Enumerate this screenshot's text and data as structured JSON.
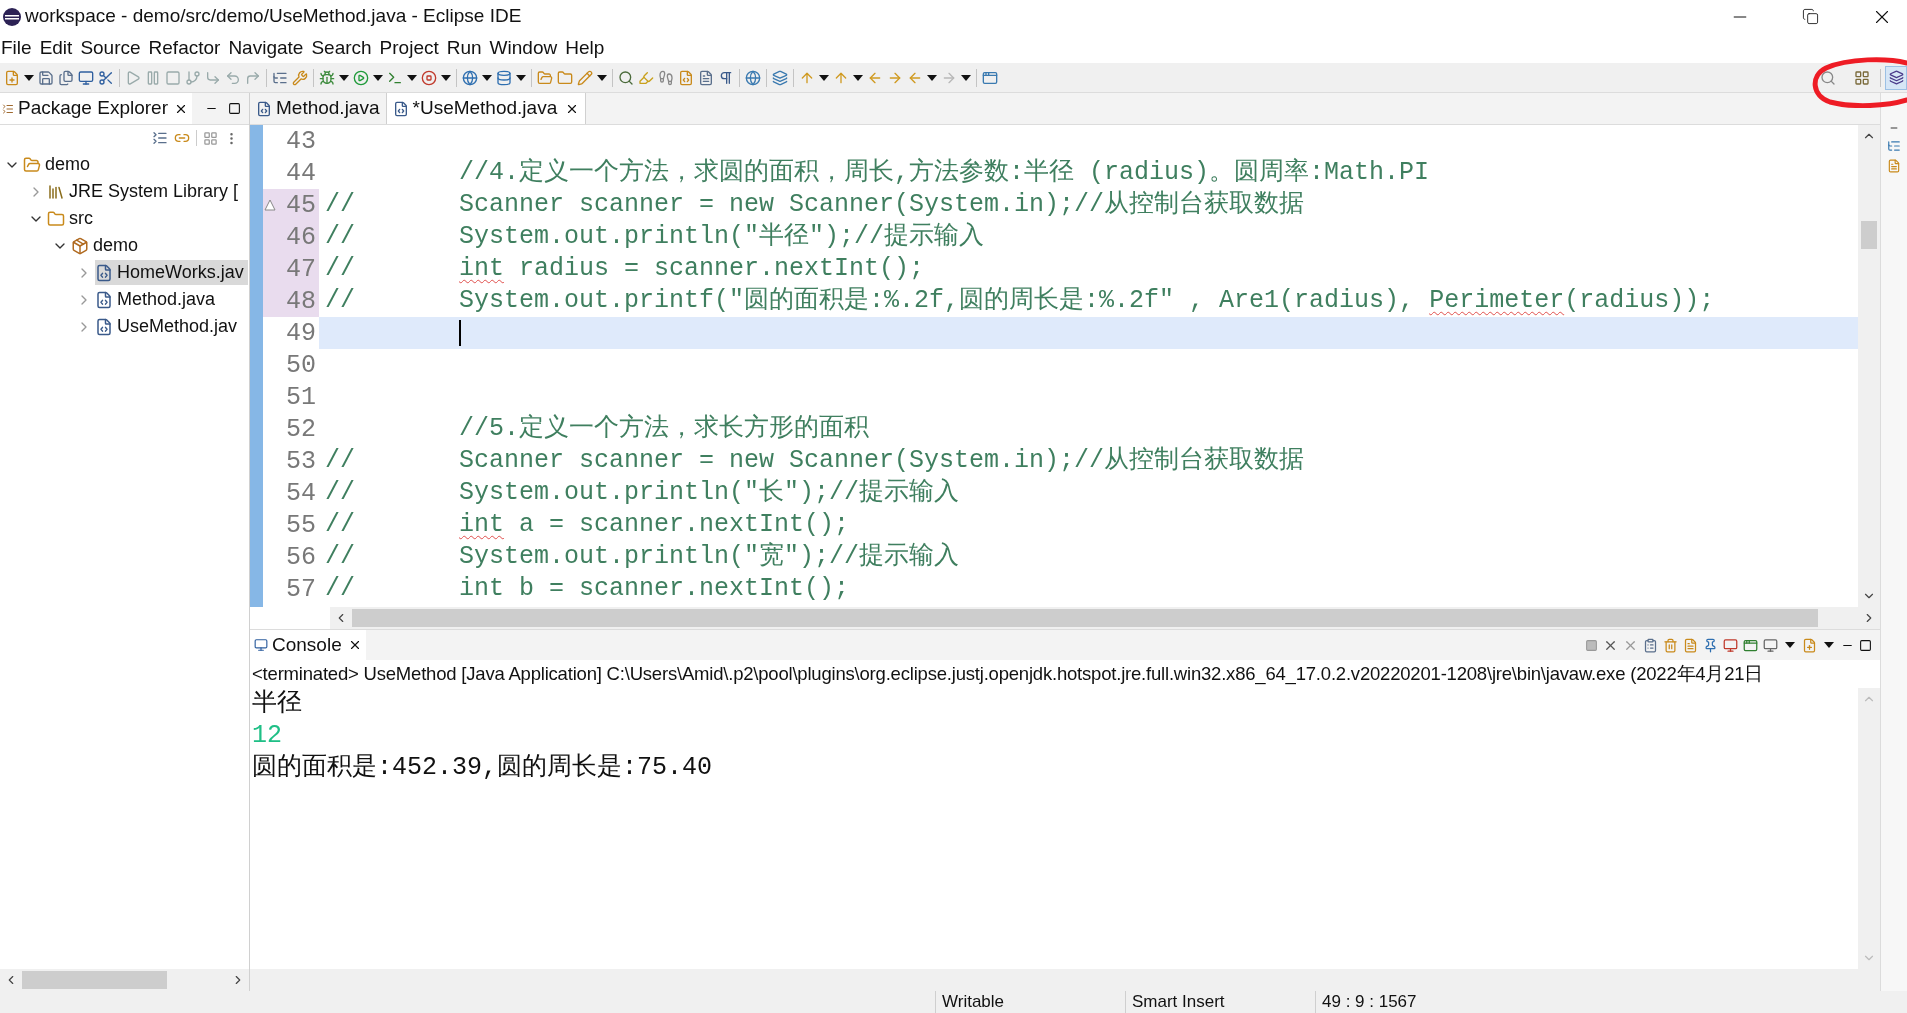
{
  "window": {
    "title": "workspace - demo/src/demo/UseMethod.java - Eclipse IDE"
  },
  "menu": [
    "File",
    "Edit",
    "Source",
    "Refactor",
    "Navigate",
    "Search",
    "Project",
    "Run",
    "Window",
    "Help"
  ],
  "package_explorer": {
    "title": "Package Explorer",
    "tree": [
      {
        "label": "demo",
        "kind": "project",
        "expanded": true,
        "selected": false,
        "children": [
          {
            "label": "JRE System Library [",
            "kind": "library",
            "expanded": false,
            "selected": false
          },
          {
            "label": "src",
            "kind": "source-folder",
            "expanded": true,
            "selected": false,
            "children": [
              {
                "label": "demo",
                "kind": "package",
                "expanded": true,
                "selected": false,
                "children": [
                  {
                    "label": "HomeWorks.jav",
                    "kind": "java-file",
                    "expanded": false,
                    "selected": true
                  },
                  {
                    "label": "Method.java",
                    "kind": "java-file",
                    "expanded": false,
                    "selected": false
                  },
                  {
                    "label": "UseMethod.jav",
                    "kind": "java-file",
                    "expanded": false,
                    "selected": false
                  }
                ]
              }
            ]
          }
        ]
      }
    ]
  },
  "editor": {
    "tabs": [
      {
        "label": "Method.java",
        "selected": false
      },
      {
        "label": "*UseMethod.java",
        "selected": true
      }
    ],
    "lines": [
      {
        "number": "43",
        "marked": false,
        "current": false,
        "warning_icon": false
      },
      {
        "number": "44",
        "marked": false,
        "current": false,
        "warning_icon": false,
        "segments": [
          {
            "text": "//4.定义一个方法，求圆的面积，周长,方法参数:半径 (radius)。圆周率:Math.PI",
            "warning": false
          }
        ]
      },
      {
        "number": "45",
        "marked": true,
        "current": false,
        "warning_icon": true,
        "prefix": "//",
        "segments": [
          {
            "text": "Scanner scanner = new Scanner(System.in);//从控制台获取数据",
            "warning": false
          }
        ]
      },
      {
        "number": "46",
        "marked": true,
        "current": false,
        "warning_icon": false,
        "prefix": "//",
        "segments": [
          {
            "text": "System.out.println(\"半径\");//提示输入",
            "warning": false
          }
        ]
      },
      {
        "number": "47",
        "marked": true,
        "current": false,
        "warning_icon": false,
        "prefix": "//",
        "segments": [
          {
            "text": "int",
            "warning": true
          },
          {
            "text": " radius = scanner.nextInt();",
            "warning": false
          }
        ]
      },
      {
        "number": "48",
        "marked": true,
        "current": false,
        "warning_icon": false,
        "prefix": "//",
        "segments": [
          {
            "text": "System.out.printf(\"圆的面积是:%.2f,圆的周长是:%.2f\" , Are1(radius), ",
            "warning": false
          },
          {
            "text": "Perimeter",
            "warning": true
          },
          {
            "text": "(radius));",
            "warning": false
          }
        ]
      },
      {
        "number": "49",
        "marked": false,
        "current": true,
        "warning_icon": false
      },
      {
        "number": "50",
        "marked": false,
        "current": false,
        "warning_icon": false
      },
      {
        "number": "51",
        "marked": false,
        "current": false,
        "warning_icon": false
      },
      {
        "number": "52",
        "marked": false,
        "current": false,
        "warning_icon": false,
        "segments": [
          {
            "text": "//5.定义一个方法，求长方形的面积",
            "warning": false
          }
        ]
      },
      {
        "number": "53",
        "marked": false,
        "current": false,
        "warning_icon": false,
        "prefix": "//",
        "segments": [
          {
            "text": "Scanner scanner = new Scanner(System.in);//从控制台获取数据",
            "warning": false
          }
        ]
      },
      {
        "number": "54",
        "marked": false,
        "current": false,
        "warning_icon": false,
        "prefix": "//",
        "segments": [
          {
            "text": "System.out.println(\"长\");//提示输入",
            "warning": false
          }
        ]
      },
      {
        "number": "55",
        "marked": false,
        "current": false,
        "warning_icon": false,
        "prefix": "//",
        "segments": [
          {
            "text": "int",
            "warning": true
          },
          {
            "text": " a = scanner.nextInt();",
            "warning": false
          }
        ]
      },
      {
        "number": "56",
        "marked": false,
        "current": false,
        "warning_icon": false,
        "prefix": "//",
        "segments": [
          {
            "text": "System.out.println(\"宽\");//提示输入",
            "warning": false
          }
        ]
      },
      {
        "number": "57",
        "marked": false,
        "current": false,
        "warning_icon": false,
        "prefix": "//",
        "segments": [
          {
            "text": "int b = scanner.nextInt();",
            "warning": false
          }
        ]
      }
    ]
  },
  "console": {
    "title": "Console",
    "launch": "<terminated> UseMethod [Java Application] C:\\Users\\Amid\\.p2\\pool\\plugins\\org.eclipse.justj.openjdk.hotspot.jre.full.win32.x86_64_17.0.2.v20220201-1208\\jre\\bin\\javaw.exe  (2022年4月21日",
    "output": [
      {
        "text": "半径",
        "kind": "output"
      },
      {
        "text": "12",
        "kind": "input"
      },
      {
        "text": "圆的面积是:452.39,圆的周长是:75.40",
        "kind": "output"
      }
    ]
  },
  "status_bar": [
    "Writable",
    "Smart Insert",
    "49 : 9 : 1567"
  ]
}
